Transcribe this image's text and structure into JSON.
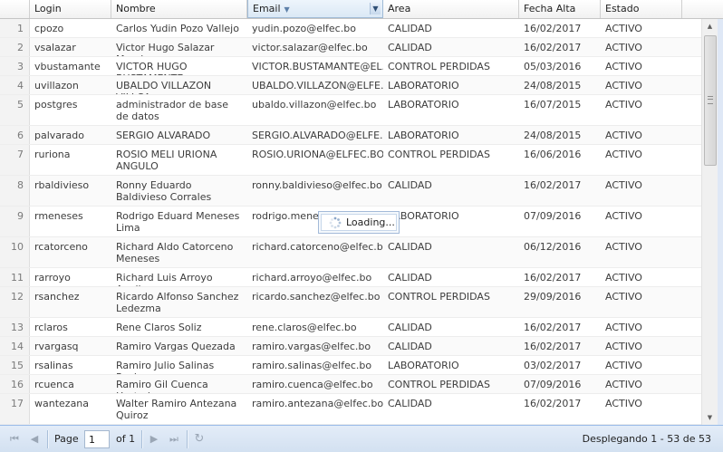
{
  "columns": {
    "login": "Login",
    "nombre": "Nombre",
    "email": "Email",
    "area": "Area",
    "fecha_alta": "Fecha Alta",
    "estado": "Estado"
  },
  "rows": [
    {
      "n": "1",
      "login": "cpozo",
      "nombre": "Carlos Yudin Pozo Vallejo",
      "email": "yudin.pozo@elfec.bo",
      "area": "CALIDAD",
      "fecha": "16/02/2017",
      "estado": "ACTIVO"
    },
    {
      "n": "2",
      "login": "vsalazar",
      "nombre": "Victor Hugo Salazar Mendez",
      "email": "victor.salazar@elfec.bo",
      "area": "CALIDAD",
      "fecha": "16/02/2017",
      "estado": "ACTIVO"
    },
    {
      "n": "3",
      "login": "vbustamante",
      "nombre": "VICTOR HUGO BUSTAMENTE",
      "email": "VICTOR.BUSTAMANTE@EL...",
      "area": "CONTROL PERDIDAS",
      "fecha": "05/03/2016",
      "estado": "ACTIVO"
    },
    {
      "n": "4",
      "login": "uvillazon",
      "nombre": "UBALDO VILLAZON VILLCA",
      "email": "UBALDO.VILLAZON@ELFE...",
      "area": "LABORATORIO",
      "fecha": "24/08/2015",
      "estado": "ACTIVO"
    },
    {
      "n": "5",
      "login": "postgres",
      "nombre": "administrador de base de datos",
      "email": "ubaldo.villazon@elfec.bo",
      "area": "LABORATORIO",
      "fecha": "16/07/2015",
      "estado": "ACTIVO"
    },
    {
      "n": "6",
      "login": "palvarado",
      "nombre": "SERGIO ALVARADO",
      "email": "SERGIO.ALVARADO@ELFE...",
      "area": "LABORATORIO",
      "fecha": "24/08/2015",
      "estado": "ACTIVO"
    },
    {
      "n": "7",
      "login": "ruriona",
      "nombre": "ROSIO MELI URIONA ANGULO",
      "email": "ROSIO.URIONA@ELFEC.BO",
      "area": "CONTROL PERDIDAS",
      "fecha": "16/06/2016",
      "estado": "ACTIVO"
    },
    {
      "n": "8",
      "login": "rbaldivieso",
      "nombre": "Ronny Eduardo Baldivieso Corrales",
      "email": "ronny.baldivieso@elfec.bo",
      "area": "CALIDAD",
      "fecha": "16/02/2017",
      "estado": "ACTIVO"
    },
    {
      "n": "9",
      "login": "rmeneses",
      "nombre": "Rodrigo Eduard Meneses Lima",
      "email": "rodrigo.menese...",
      "area": "LABORATORIO",
      "fecha": "07/09/2016",
      "estado": "ACTIVO"
    },
    {
      "n": "10",
      "login": "rcatorceno",
      "nombre": "Richard Aldo Catorceno Meneses",
      "email": "richard.catorceno@elfec.bo",
      "area": "CALIDAD",
      "fecha": "06/12/2016",
      "estado": "ACTIVO"
    },
    {
      "n": "11",
      "login": "rarroyo",
      "nombre": "Richard Luis Arroyo Aguilar",
      "email": "richard.arroyo@elfec.bo",
      "area": "CALIDAD",
      "fecha": "16/02/2017",
      "estado": "ACTIVO"
    },
    {
      "n": "12",
      "login": "rsanchez",
      "nombre": "Ricardo Alfonso Sanchez Ledezma",
      "email": "ricardo.sanchez@elfec.bo",
      "area": "CONTROL PERDIDAS",
      "fecha": "29/09/2016",
      "estado": "ACTIVO"
    },
    {
      "n": "13",
      "login": "rclaros",
      "nombre": "Rene Claros Soliz",
      "email": "rene.claros@elfec.bo",
      "area": "CALIDAD",
      "fecha": "16/02/2017",
      "estado": "ACTIVO"
    },
    {
      "n": "14",
      "login": "rvargasq",
      "nombre": "Ramiro Vargas Quezada",
      "email": "ramiro.vargas@elfec.bo",
      "area": "CALIDAD",
      "fecha": "16/02/2017",
      "estado": "ACTIVO"
    },
    {
      "n": "15",
      "login": "rsalinas",
      "nombre": "Ramiro Julio Salinas Rocha",
      "email": "ramiro.salinas@elfec.bo",
      "area": "LABORATORIO",
      "fecha": "03/02/2017",
      "estado": "ACTIVO"
    },
    {
      "n": "16",
      "login": "rcuenca",
      "nombre": "Ramiro Gil Cuenca Hurtado",
      "email": "ramiro.cuenca@elfec.bo",
      "area": "CONTROL PERDIDAS",
      "fecha": "07/09/2016",
      "estado": "ACTIVO"
    },
    {
      "n": "17",
      "login": "wantezana",
      "nombre": "Walter Ramiro Antezana Quiroz",
      "email": "ramiro.antezana@elfec.bo",
      "area": "CALIDAD",
      "fecha": "16/02/2017",
      "estado": "ACTIVO"
    }
  ],
  "loading": {
    "text": "Loading..."
  },
  "paging": {
    "page_label": "Page",
    "page_value": "1",
    "of_label": "of 1",
    "display_text": "Desplegando 1 - 53 de 53"
  },
  "icons": {
    "first": "first-page-icon",
    "prev": "prev-page-icon",
    "next": "next-page-icon",
    "last": "last-page-icon",
    "refresh": "refresh-icon"
  }
}
